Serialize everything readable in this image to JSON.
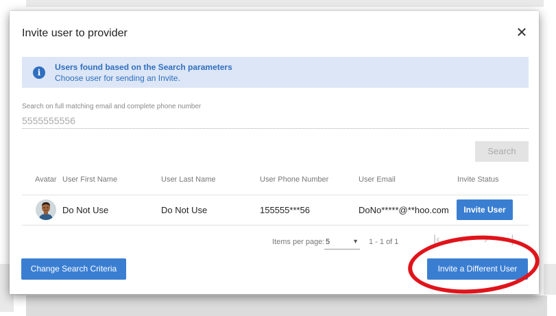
{
  "dialog": {
    "title": "Invite user to provider",
    "close_icon": "close-icon"
  },
  "banner": {
    "icon": "info-icon",
    "icon_glyph": "i",
    "title": "Users found based on the Search parameters",
    "subtitle": "Choose user for sending an Invite."
  },
  "search": {
    "label": "Search on full matching email and complete phone number",
    "value": "5555555556",
    "button_label": "Search"
  },
  "table": {
    "headers": [
      "Avatar",
      "User First Name",
      "User Last Name",
      "User Phone Number",
      "User Email",
      "Invite Status"
    ],
    "rows": [
      {
        "avatar": "user-avatar-icon",
        "first_name": "Do Not Use",
        "last_name": "Do Not Use",
        "phone": "155555***56",
        "email": "DoNo*****@**hoo.com",
        "action_label": "Invite User"
      }
    ]
  },
  "pagination": {
    "items_per_page_label": "Items per page:",
    "items_per_page_value": "5",
    "range": "1 - 1 of 1"
  },
  "footer": {
    "change_label": "Change Search Criteria",
    "invite_different_label": "Invite a Different User"
  },
  "colors": {
    "primary": "#3a7ed2",
    "banner_bg": "#dce6f6",
    "annotation": "#e0141b"
  }
}
